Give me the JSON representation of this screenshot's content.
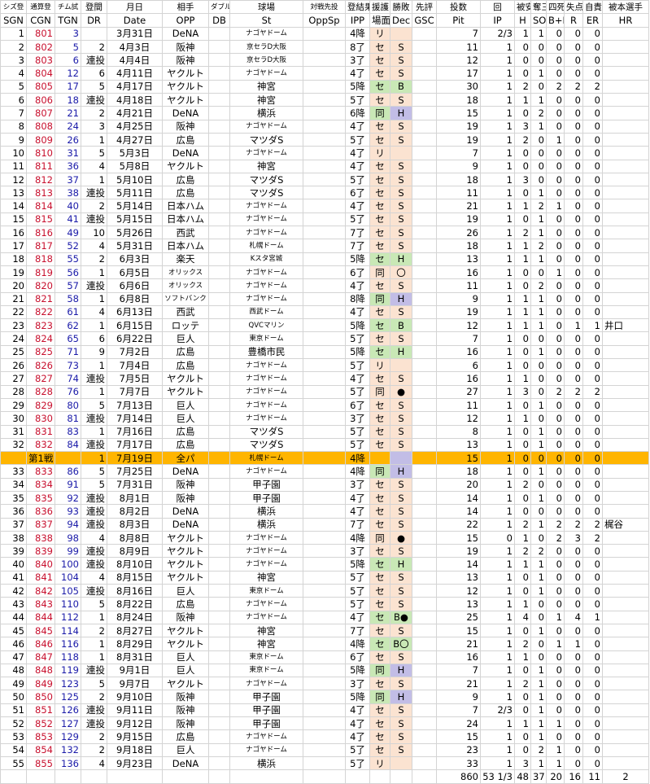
{
  "headers_top": [
    "シズ登",
    "通算登",
    "チム試",
    "登間",
    "月日",
    "相手",
    "ダブル",
    "球場",
    "対戦先投",
    "登結果",
    "援護",
    "勝敗",
    "先評",
    "投数",
    "回",
    "被安",
    "奪三",
    "四死",
    "失点",
    "自責",
    "被本選手"
  ],
  "headers_bottom": [
    "SGN",
    "CGN",
    "TGN",
    "DR",
    "Date",
    "OPP",
    "DB",
    "St",
    "OppSp",
    "IPP",
    "場面",
    "Dec",
    "GSC",
    "Pit",
    "IP",
    "H",
    "SO",
    "B+H",
    "R",
    "ER",
    "HR"
  ],
  "rows": [
    [
      "1",
      "801",
      "3",
      "",
      "3月31日",
      "DeNA",
      "",
      "ナゴヤドーム",
      "",
      "4降",
      "リ",
      "",
      "",
      "7",
      "2/3",
      "1",
      "1",
      "0",
      "0",
      "0",
      ""
    ],
    [
      "2",
      "802",
      "5",
      "2",
      "4月3日",
      "阪神",
      "",
      "京セラD大阪",
      "",
      "8了",
      "セ",
      "S",
      "",
      "11",
      "1",
      "0",
      "0",
      "0",
      "0",
      "0",
      ""
    ],
    [
      "3",
      "803",
      "6",
      "連投",
      "4月4日",
      "阪神",
      "",
      "京セラD大阪",
      "",
      "3了",
      "セ",
      "S",
      "",
      "12",
      "1",
      "0",
      "0",
      "0",
      "0",
      "0",
      ""
    ],
    [
      "4",
      "804",
      "12",
      "6",
      "4月11日",
      "ヤクルト",
      "",
      "ナゴヤドーム",
      "",
      "4了",
      "セ",
      "S",
      "",
      "17",
      "1",
      "0",
      "1",
      "0",
      "0",
      "0",
      ""
    ],
    [
      "5",
      "805",
      "17",
      "5",
      "4月17日",
      "ヤクルト",
      "",
      "神宮",
      "",
      "5降",
      "セ",
      "B",
      "",
      "30",
      "1",
      "2",
      "0",
      "2",
      "2",
      "2",
      ""
    ],
    [
      "6",
      "806",
      "18",
      "連投",
      "4月18日",
      "ヤクルト",
      "",
      "神宮",
      "",
      "5了",
      "セ",
      "S",
      "",
      "18",
      "1",
      "1",
      "1",
      "0",
      "0",
      "0",
      ""
    ],
    [
      "7",
      "807",
      "21",
      "2",
      "4月21日",
      "DeNA",
      "",
      "横浜",
      "",
      "6降",
      "同",
      "H",
      "",
      "15",
      "1",
      "0",
      "2",
      "0",
      "0",
      "0",
      ""
    ],
    [
      "8",
      "808",
      "24",
      "3",
      "4月25日",
      "阪神",
      "",
      "ナゴヤドーム",
      "",
      "4了",
      "セ",
      "S",
      "",
      "19",
      "1",
      "3",
      "1",
      "0",
      "0",
      "0",
      ""
    ],
    [
      "9",
      "809",
      "26",
      "1",
      "4月27日",
      "広島",
      "",
      "マツダS",
      "",
      "5了",
      "セ",
      "S",
      "",
      "19",
      "1",
      "2",
      "0",
      "1",
      "0",
      "0",
      ""
    ],
    [
      "10",
      "810",
      "31",
      "5",
      "5月3日",
      "DeNA",
      "",
      "ナゴヤドーム",
      "",
      "4了",
      "リ",
      "",
      "",
      "7",
      "1",
      "0",
      "0",
      "0",
      "0",
      "0",
      ""
    ],
    [
      "11",
      "811",
      "36",
      "4",
      "5月8日",
      "ヤクルト",
      "",
      "神宮",
      "",
      "4了",
      "セ",
      "S",
      "",
      "9",
      "1",
      "0",
      "0",
      "0",
      "0",
      "0",
      ""
    ],
    [
      "12",
      "812",
      "37",
      "1",
      "5月10日",
      "広島",
      "",
      "マツダS",
      "",
      "5了",
      "セ",
      "S",
      "",
      "18",
      "1",
      "3",
      "0",
      "0",
      "0",
      "0",
      ""
    ],
    [
      "13",
      "813",
      "38",
      "連投",
      "5月11日",
      "広島",
      "",
      "マツダS",
      "",
      "6了",
      "セ",
      "S",
      "",
      "11",
      "1",
      "0",
      "1",
      "0",
      "0",
      "0",
      ""
    ],
    [
      "14",
      "814",
      "40",
      "2",
      "5月14日",
      "日本ハム",
      "",
      "ナゴヤドーム",
      "",
      "4了",
      "セ",
      "S",
      "",
      "21",
      "1",
      "1",
      "2",
      "1",
      "0",
      "0",
      ""
    ],
    [
      "15",
      "815",
      "41",
      "連投",
      "5月15日",
      "日本ハム",
      "",
      "ナゴヤドーム",
      "",
      "5了",
      "セ",
      "S",
      "",
      "19",
      "1",
      "0",
      "1",
      "0",
      "0",
      "0",
      ""
    ],
    [
      "16",
      "816",
      "49",
      "10",
      "5月26日",
      "西武",
      "",
      "ナゴヤドーム",
      "",
      "7了",
      "セ",
      "S",
      "",
      "26",
      "1",
      "2",
      "1",
      "0",
      "0",
      "0",
      ""
    ],
    [
      "17",
      "817",
      "52",
      "4",
      "5月31日",
      "日本ハム",
      "",
      "札幌ドーム",
      "",
      "7了",
      "セ",
      "S",
      "",
      "18",
      "1",
      "1",
      "2",
      "0",
      "0",
      "0",
      ""
    ],
    [
      "18",
      "818",
      "55",
      "2",
      "6月3日",
      "楽天",
      "",
      "Kスタ宮城",
      "",
      "5降",
      "セ",
      "H",
      "",
      "13",
      "1",
      "1",
      "1",
      "0",
      "0",
      "0",
      ""
    ],
    [
      "19",
      "819",
      "56",
      "1",
      "6月5日",
      "オリックス",
      "",
      "ナゴヤドーム",
      "",
      "6了",
      "同",
      "〇",
      "",
      "16",
      "1",
      "0",
      "0",
      "1",
      "0",
      "0",
      ""
    ],
    [
      "20",
      "820",
      "57",
      "連投",
      "6月6日",
      "オリックス",
      "",
      "ナゴヤドーム",
      "",
      "4了",
      "セ",
      "S",
      "",
      "11",
      "1",
      "0",
      "2",
      "0",
      "0",
      "0",
      ""
    ],
    [
      "21",
      "821",
      "58",
      "1",
      "6月8日",
      "ソフトバンク",
      "",
      "ナゴヤドーム",
      "",
      "8降",
      "同",
      "H",
      "",
      "9",
      "1",
      "1",
      "1",
      "0",
      "0",
      "0",
      ""
    ],
    [
      "22",
      "822",
      "61",
      "4",
      "6月13日",
      "西武",
      "",
      "西武ドーム",
      "",
      "4了",
      "セ",
      "S",
      "",
      "19",
      "1",
      "1",
      "1",
      "0",
      "0",
      "0",
      ""
    ],
    [
      "23",
      "823",
      "62",
      "1",
      "6月15日",
      "ロッテ",
      "",
      "QVCマリン",
      "",
      "5降",
      "セ",
      "B",
      "",
      "12",
      "1",
      "1",
      "1",
      "0",
      "1",
      "1",
      "井口"
    ],
    [
      "24",
      "824",
      "65",
      "6",
      "6月22日",
      "巨人",
      "",
      "東京ドーム",
      "",
      "5了",
      "セ",
      "S",
      "",
      "7",
      "1",
      "0",
      "0",
      "0",
      "0",
      "0",
      ""
    ],
    [
      "25",
      "825",
      "71",
      "9",
      "7月2日",
      "広島",
      "",
      "豊橋市民",
      "",
      "5降",
      "セ",
      "H",
      "",
      "16",
      "1",
      "0",
      "1",
      "0",
      "0",
      "0",
      ""
    ],
    [
      "26",
      "826",
      "73",
      "1",
      "7月4日",
      "広島",
      "",
      "ナゴヤドーム",
      "",
      "5了",
      "リ",
      "",
      "",
      "6",
      "1",
      "0",
      "0",
      "0",
      "0",
      "0",
      ""
    ],
    [
      "27",
      "827",
      "74",
      "連投",
      "7月5日",
      "ヤクルト",
      "",
      "ナゴヤドーム",
      "",
      "4了",
      "セ",
      "S",
      "",
      "16",
      "1",
      "1",
      "0",
      "0",
      "0",
      "0",
      ""
    ],
    [
      "28",
      "828",
      "76",
      "1",
      "7月7日",
      "ヤクルト",
      "",
      "ナゴヤドーム",
      "",
      "5了",
      "同",
      "●",
      "",
      "27",
      "1",
      "3",
      "0",
      "2",
      "2",
      "2",
      ""
    ],
    [
      "29",
      "829",
      "80",
      "5",
      "7月13日",
      "巨人",
      "",
      "ナゴヤドーム",
      "",
      "6了",
      "セ",
      "S",
      "",
      "11",
      "1",
      "0",
      "1",
      "0",
      "0",
      "0",
      ""
    ],
    [
      "30",
      "830",
      "81",
      "連投",
      "7月14日",
      "巨人",
      "",
      "ナゴヤドーム",
      "",
      "3了",
      "セ",
      "S",
      "",
      "12",
      "1",
      "1",
      "0",
      "0",
      "0",
      "0",
      ""
    ],
    [
      "31",
      "831",
      "83",
      "1",
      "7月16日",
      "広島",
      "",
      "マツダS",
      "",
      "5了",
      "セ",
      "S",
      "",
      "8",
      "1",
      "0",
      "1",
      "0",
      "0",
      "0",
      ""
    ],
    [
      "32",
      "832",
      "84",
      "連投",
      "7月17日",
      "広島",
      "",
      "マツダS",
      "",
      "5了",
      "セ",
      "S",
      "",
      "13",
      "1",
      "0",
      "1",
      "0",
      "0",
      "0",
      ""
    ]
  ],
  "allstar_row": [
    "",
    "第1戦",
    "",
    "1",
    "7月19日",
    "全パ",
    "",
    "札幌ドーム",
    "",
    "4降",
    "",
    "",
    "",
    "15",
    "1",
    "0",
    "0",
    "0",
    "0",
    "0",
    ""
  ],
  "rows2": [
    [
      "33",
      "833",
      "86",
      "5",
      "7月25日",
      "DeNA",
      "",
      "ナゴヤドーム",
      "",
      "4降",
      "同",
      "H",
      "",
      "18",
      "1",
      "0",
      "1",
      "0",
      "0",
      "0",
      ""
    ],
    [
      "34",
      "834",
      "91",
      "5",
      "7月31日",
      "阪神",
      "",
      "甲子園",
      "",
      "3了",
      "セ",
      "S",
      "",
      "20",
      "1",
      "2",
      "0",
      "0",
      "0",
      "0",
      ""
    ],
    [
      "35",
      "835",
      "92",
      "連投",
      "8月1日",
      "阪神",
      "",
      "甲子園",
      "",
      "4了",
      "セ",
      "S",
      "",
      "14",
      "1",
      "0",
      "1",
      "0",
      "0",
      "0",
      ""
    ],
    [
      "36",
      "836",
      "93",
      "連投",
      "8月2日",
      "DeNA",
      "",
      "横浜",
      "",
      "4了",
      "セ",
      "S",
      "",
      "14",
      "1",
      "0",
      "0",
      "0",
      "0",
      "0",
      ""
    ],
    [
      "37",
      "837",
      "94",
      "連投",
      "8月3日",
      "DeNA",
      "",
      "横浜",
      "",
      "7了",
      "セ",
      "S",
      "",
      "22",
      "1",
      "2",
      "1",
      "2",
      "2",
      "2",
      "梶谷"
    ],
    [
      "38",
      "838",
      "98",
      "4",
      "8月8日",
      "ヤクルト",
      "",
      "ナゴヤドーム",
      "",
      "4降",
      "同",
      "●",
      "",
      "15",
      "0",
      "1",
      "0",
      "2",
      "3",
      "2",
      ""
    ],
    [
      "39",
      "839",
      "99",
      "連投",
      "8月9日",
      "ヤクルト",
      "",
      "ナゴヤドーム",
      "",
      "3了",
      "セ",
      "S",
      "",
      "19",
      "1",
      "2",
      "2",
      "0",
      "0",
      "0",
      ""
    ],
    [
      "40",
      "840",
      "100",
      "連投",
      "8月10日",
      "ヤクルト",
      "",
      "ナゴヤドーム",
      "",
      "5降",
      "セ",
      "H",
      "",
      "14",
      "1",
      "1",
      "1",
      "0",
      "0",
      "0",
      ""
    ],
    [
      "41",
      "841",
      "104",
      "4",
      "8月15日",
      "ヤクルト",
      "",
      "神宮",
      "",
      "5了",
      "セ",
      "S",
      "",
      "13",
      "1",
      "0",
      "1",
      "0",
      "0",
      "0",
      ""
    ],
    [
      "42",
      "842",
      "105",
      "連投",
      "8月16日",
      "巨人",
      "",
      "東京ドーム",
      "",
      "5了",
      "セ",
      "S",
      "",
      "12",
      "1",
      "0",
      "1",
      "0",
      "0",
      "0",
      ""
    ],
    [
      "43",
      "843",
      "110",
      "5",
      "8月22日",
      "広島",
      "",
      "ナゴヤドーム",
      "",
      "5了",
      "セ",
      "S",
      "",
      "13",
      "1",
      "1",
      "0",
      "0",
      "0",
      "0",
      ""
    ],
    [
      "44",
      "844",
      "112",
      "1",
      "8月24日",
      "阪神",
      "",
      "ナゴヤドーム",
      "",
      "4了",
      "セ",
      "B●",
      "",
      "25",
      "1",
      "4",
      "0",
      "1",
      "4",
      "1",
      ""
    ],
    [
      "45",
      "845",
      "114",
      "2",
      "8月27日",
      "ヤクルト",
      "",
      "神宮",
      "",
      "7了",
      "セ",
      "S",
      "",
      "15",
      "1",
      "0",
      "1",
      "0",
      "0",
      "0",
      ""
    ],
    [
      "46",
      "846",
      "116",
      "1",
      "8月29日",
      "ヤクルト",
      "",
      "神宮",
      "",
      "4降",
      "セ",
      "B〇",
      "",
      "21",
      "1",
      "2",
      "0",
      "1",
      "1",
      "0",
      ""
    ],
    [
      "47",
      "847",
      "118",
      "1",
      "8月31日",
      "巨人",
      "",
      "東京ドーム",
      "",
      "6了",
      "セ",
      "S",
      "",
      "16",
      "1",
      "1",
      "0",
      "0",
      "0",
      "0",
      ""
    ],
    [
      "48",
      "848",
      "119",
      "連投",
      "9月1日",
      "巨人",
      "",
      "東京ドーム",
      "",
      "5降",
      "同",
      "H",
      "",
      "7",
      "1",
      "0",
      "1",
      "0",
      "0",
      "0",
      ""
    ],
    [
      "49",
      "849",
      "123",
      "5",
      "9月7日",
      "ヤクルト",
      "",
      "ナゴヤドーム",
      "",
      "3了",
      "セ",
      "S",
      "",
      "21",
      "1",
      "2",
      "1",
      "0",
      "0",
      "0",
      ""
    ],
    [
      "50",
      "850",
      "125",
      "2",
      "9月10日",
      "阪神",
      "",
      "甲子園",
      "",
      "5降",
      "同",
      "H",
      "",
      "9",
      "1",
      "0",
      "1",
      "0",
      "0",
      "0",
      ""
    ],
    [
      "51",
      "851",
      "126",
      "連投",
      "9月11日",
      "阪神",
      "",
      "甲子園",
      "",
      "4了",
      "セ",
      "S",
      "",
      "7",
      "2/3",
      "0",
      "1",
      "0",
      "0",
      "0",
      ""
    ],
    [
      "52",
      "852",
      "127",
      "連投",
      "9月12日",
      "阪神",
      "",
      "甲子園",
      "",
      "4了",
      "セ",
      "S",
      "",
      "24",
      "1",
      "1",
      "1",
      "1",
      "0",
      "0",
      ""
    ],
    [
      "53",
      "853",
      "129",
      "2",
      "9月15日",
      "広島",
      "",
      "ナゴヤドーム",
      "",
      "4了",
      "セ",
      "S",
      "",
      "15",
      "1",
      "0",
      "1",
      "0",
      "0",
      "0",
      ""
    ],
    [
      "54",
      "854",
      "132",
      "2",
      "9月18日",
      "巨人",
      "",
      "ナゴヤドーム",
      "",
      "5了",
      "セ",
      "S",
      "",
      "23",
      "1",
      "0",
      "2",
      "1",
      "0",
      "0",
      ""
    ],
    [
      "55",
      "855",
      "136",
      "4",
      "9月23日",
      "DeNA",
      "",
      "横浜",
      "",
      "5了",
      "リ",
      "",
      "",
      "33",
      "1",
      "3",
      "1",
      "1",
      "0",
      "0",
      ""
    ]
  ],
  "totals": [
    "",
    "",
    "",
    "",
    "",
    "",
    "",
    "",
    "",
    "",
    "",
    "",
    "",
    "860",
    "53 1/3",
    "48",
    "37",
    "20",
    "16",
    "11",
    "2"
  ],
  "colors": {
    "red": "#c8102e",
    "blue": "#1a1aa8",
    "peach": "#fbe3d1",
    "green": "#c9e8b6",
    "purple": "#c2bde6",
    "allstar": "#ffb500"
  }
}
